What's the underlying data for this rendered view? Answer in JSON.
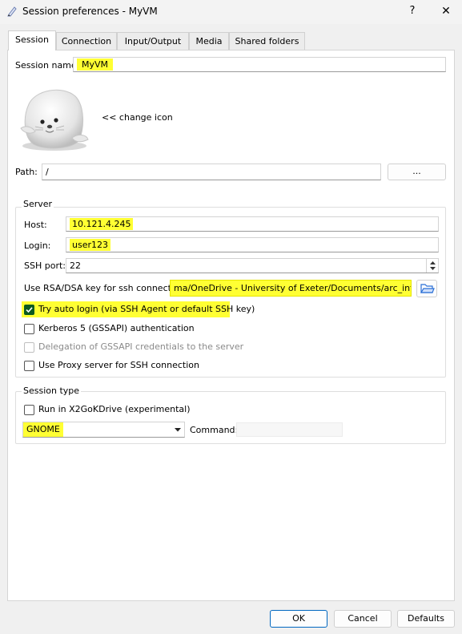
{
  "window": {
    "title": "Session preferences - MyVM",
    "help_glyph": "?",
    "close_glyph": "✕"
  },
  "tabs": [
    {
      "label": "Session",
      "active": true
    },
    {
      "label": "Connection",
      "active": false
    },
    {
      "label": "Input/Output",
      "active": false
    },
    {
      "label": "Media",
      "active": false
    },
    {
      "label": "Shared folders",
      "active": false
    }
  ],
  "session": {
    "name_label": "Session name:",
    "name_value": "MyVM",
    "change_icon_label": "<< change icon",
    "path_label": "Path:",
    "path_value": "/",
    "path_button": "..."
  },
  "server": {
    "group_title": "Server",
    "host_label": "Host:",
    "host_value": "10.121.4.245",
    "login_label": "Login:",
    "login_value": "user123",
    "ssh_port_label": "SSH port:",
    "ssh_port_value": "22",
    "key_label": "Use RSA/DSA key for ssh connection:",
    "key_value": "ma/OneDrive - University of Exeter/Documents/arc_intro.key",
    "auto_login_label": "Try auto login (via SSH Agent or default SSH key)",
    "auto_login_checked": true,
    "kerberos_label": "Kerberos 5 (GSSAPI) authentication",
    "delegation_label": "Delegation of GSSAPI credentials to the server",
    "proxy_label": "Use Proxy server for SSH connection"
  },
  "session_type": {
    "group_title": "Session type",
    "x2gokdrive_label": "Run in X2GoKDrive (experimental)",
    "type_value": "GNOME",
    "command_label": "Command:",
    "command_value": ""
  },
  "footer": {
    "ok": "OK",
    "cancel": "Cancel",
    "defaults": "Defaults"
  },
  "colors": {
    "highlight": "#ffff33",
    "checked": "#0c5a1f",
    "folder_icon": "#2a6fd6"
  }
}
